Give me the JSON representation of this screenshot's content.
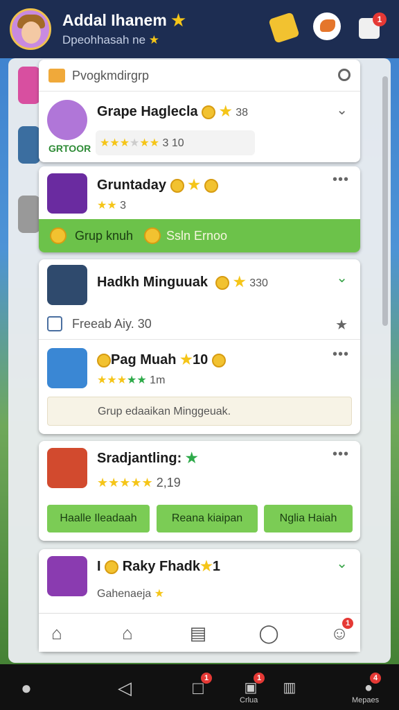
{
  "header": {
    "user_name": "Addal Ihanem",
    "user_sub": "Dpeohhasah ne",
    "badge_tools": "1"
  },
  "search": {
    "placeholder": "Pvogkmdirgrp"
  },
  "cards": {
    "c1": {
      "title": "Grape Haglecla",
      "count": "38",
      "rating_text": "3 10",
      "tag": "GRTOOR"
    },
    "c2": {
      "title": "Gruntaday",
      "rating_text": "3",
      "banner_left": "Grup knuh",
      "banner_right": "Ssln Ernoo"
    },
    "c3": {
      "title": "Hadkh Minguuak",
      "count": "330",
      "sub_label": "Freeab Aiy. 30",
      "inner_title": "Pag Muah",
      "inner_count": "10",
      "inner_rating_text": "1m",
      "note": "Grup edaaikan Minggeuak."
    },
    "c4": {
      "title": "Sradjantling:",
      "rating_text": "2,19",
      "btn1": "Haalle Ileadaah",
      "btn2": "Reana kiaipan",
      "btn3": "Nglia Haiah"
    },
    "c5": {
      "title": "Raky Fhadk",
      "count": "1",
      "prefix": "I",
      "sub": "Gahenaeja"
    }
  },
  "nav": {
    "badge": "1"
  },
  "system": {
    "badge1": "1",
    "badge2": "1",
    "badge3": "4",
    "label1": "Crlua",
    "label2": "Mepaes"
  },
  "colors": {
    "topbar": "#1d2d52",
    "green": "#7bcc55",
    "star": "#f5c518",
    "badge": "#e53935"
  }
}
